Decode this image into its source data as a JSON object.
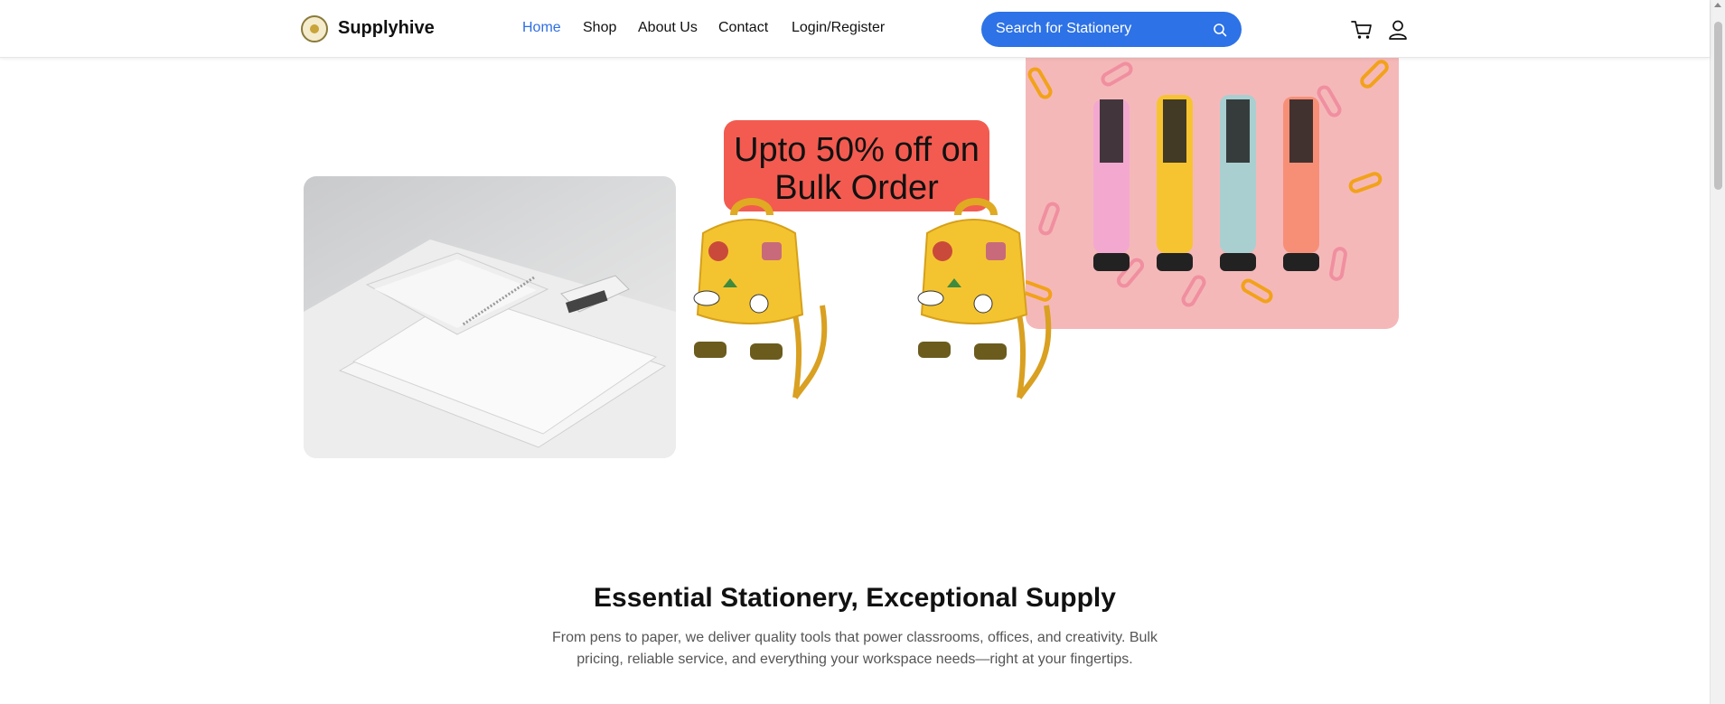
{
  "header": {
    "brand": "Supplyhive",
    "nav": [
      {
        "label": "Home",
        "active": true
      },
      {
        "label": "Shop",
        "active": false
      },
      {
        "label": "About Us",
        "active": false
      },
      {
        "label": "Contact",
        "active": false
      },
      {
        "label": "Login/Register",
        "active": false
      }
    ],
    "search": {
      "placeholder": "Search for Stationery",
      "icon": "search-icon"
    },
    "icons": [
      "cart-icon",
      "user-icon"
    ]
  },
  "hero": {
    "promo_text": "Upto 50% off on Bulk Order"
  },
  "intro": {
    "title": "Essential Stationery, Exceptional Supply",
    "description": "From pens to paper, we deliver quality tools that power classrooms, offices, and creativity. Bulk pricing, reliable service, and everything your workspace needs—right at your fingertips."
  },
  "colors": {
    "accent": "#2d72e6",
    "promo": "#f35b50",
    "highlighter_bg": "#f5b8b9"
  }
}
